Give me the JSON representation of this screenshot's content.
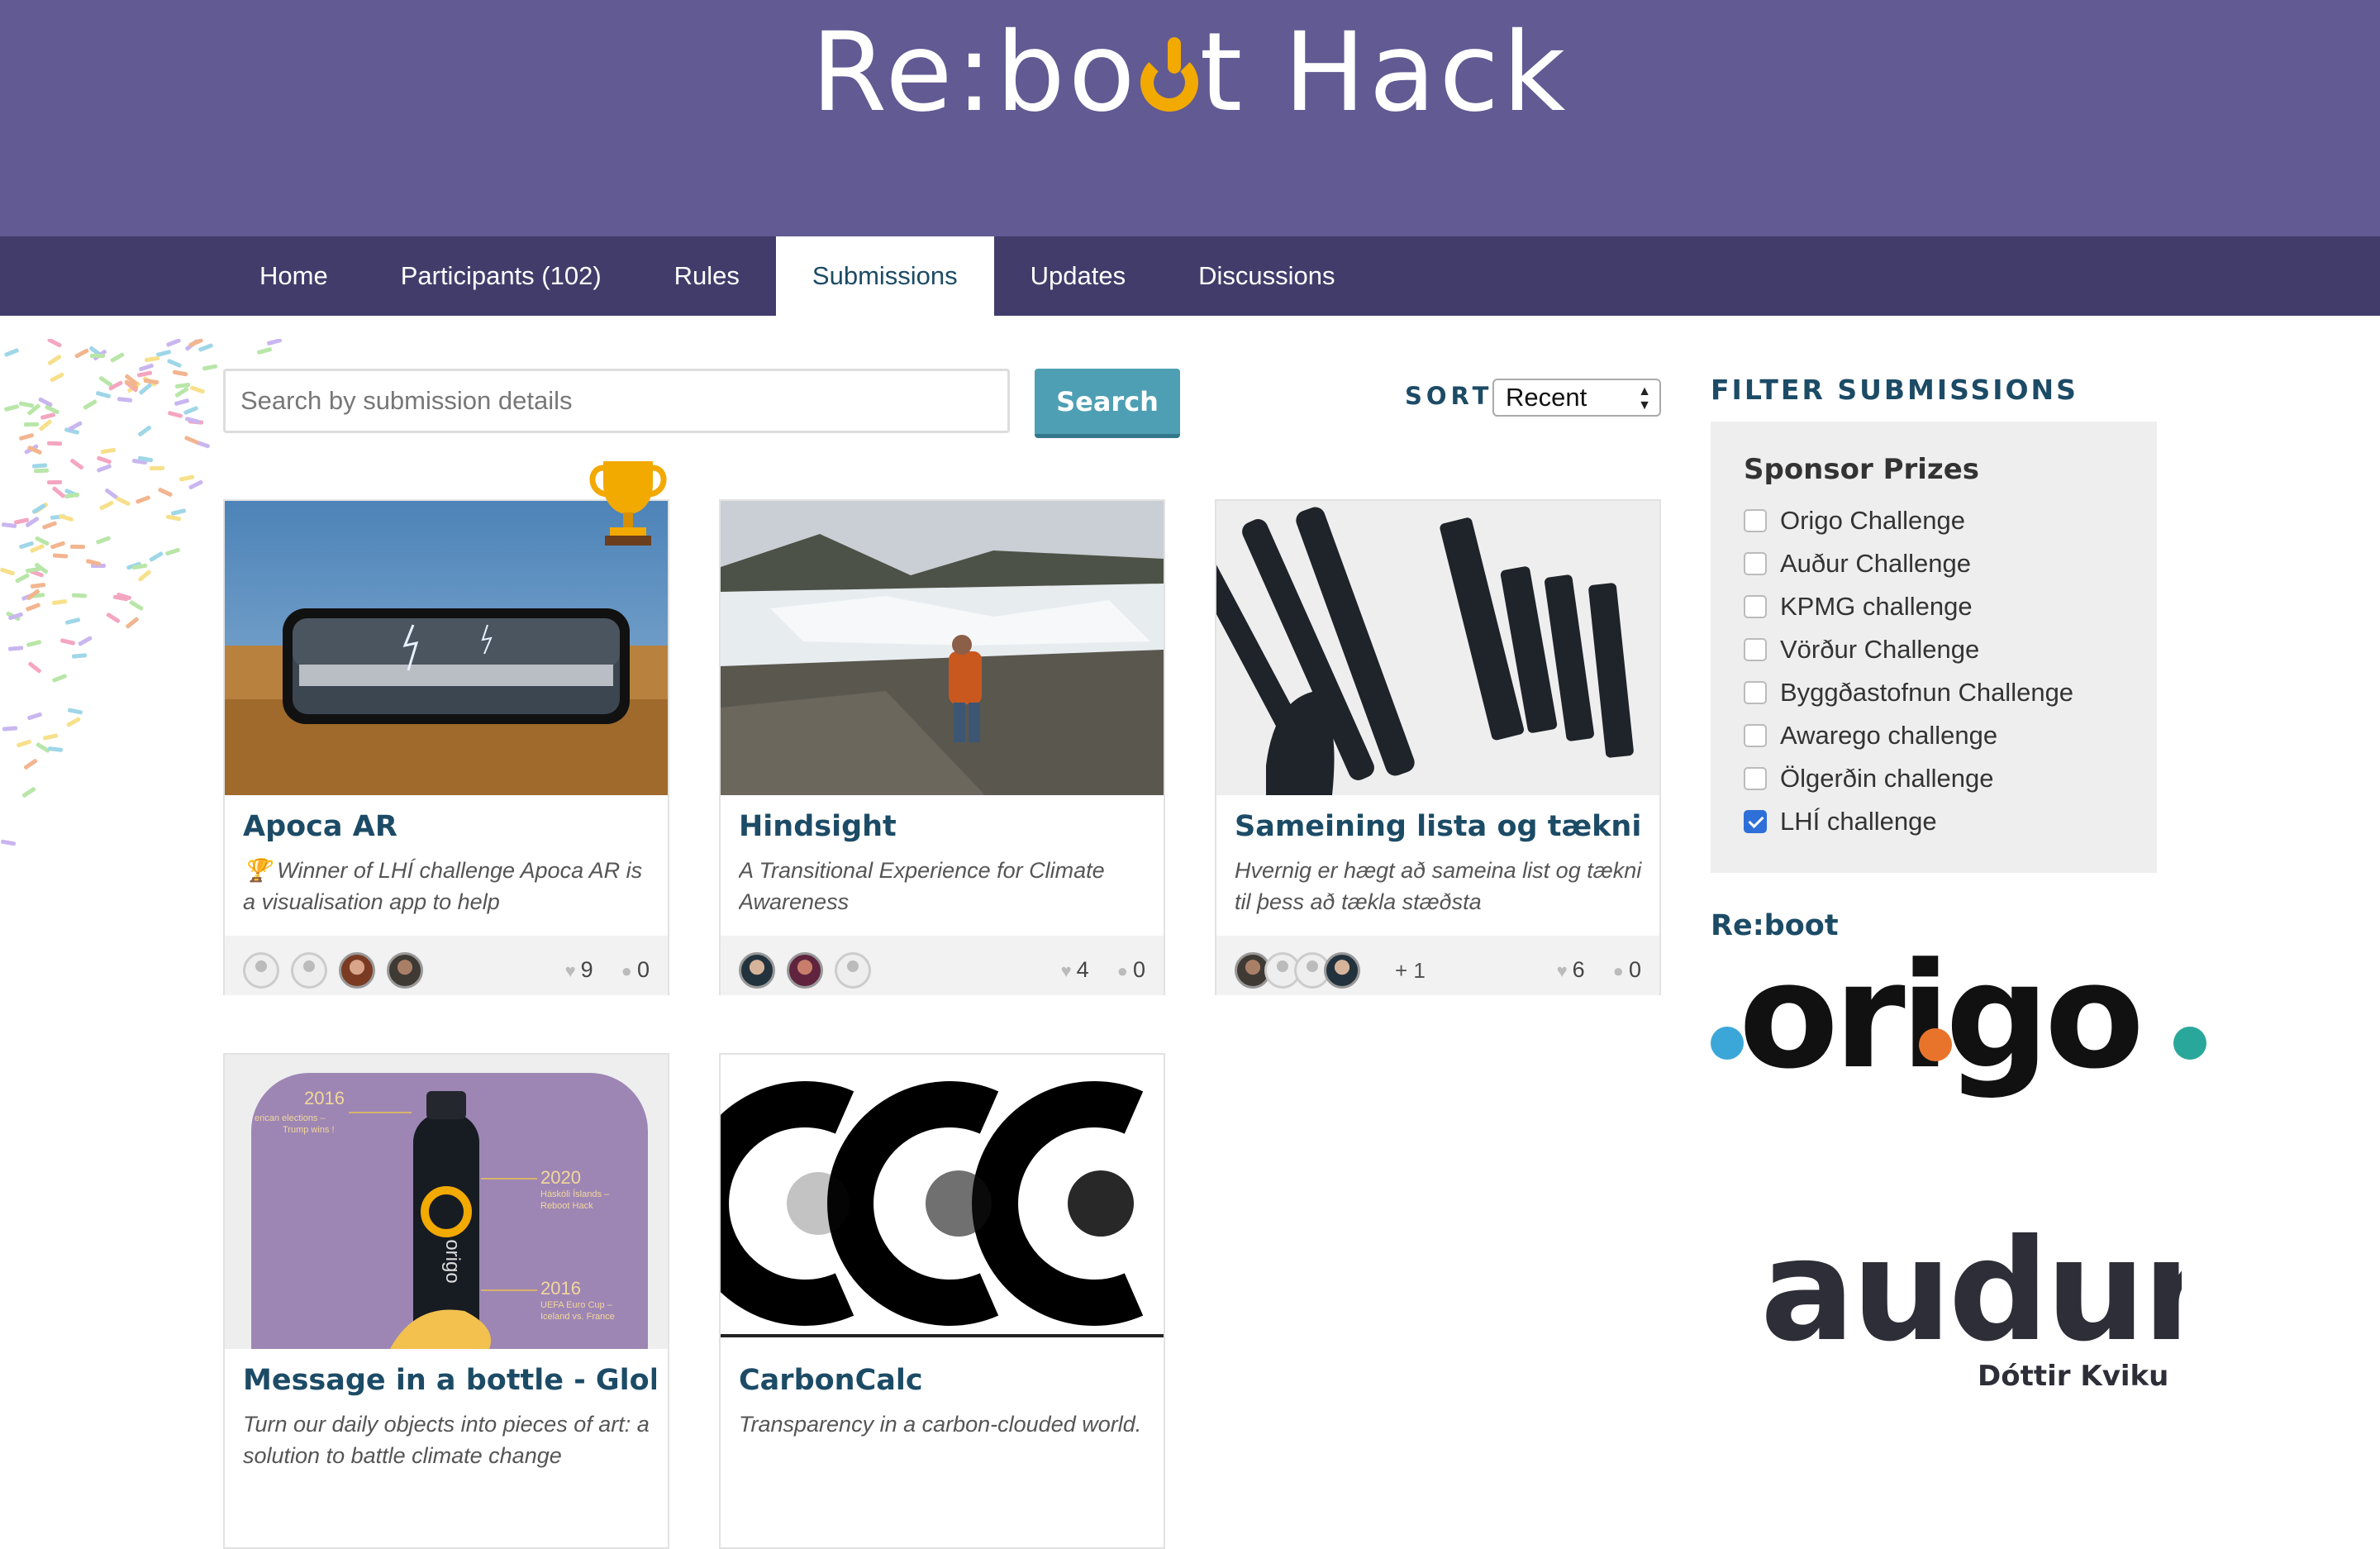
{
  "header": {
    "logo_text": "Re:boot Hack",
    "logo_part1": "Re:bo",
    "logo_part2": "t Hack"
  },
  "nav": [
    {
      "label": "Home"
    },
    {
      "label": "Participants (102)"
    },
    {
      "label": "Rules"
    },
    {
      "label": "Submissions",
      "active": true
    },
    {
      "label": "Updates"
    },
    {
      "label": "Discussions"
    }
  ],
  "search": {
    "placeholder": "Search by submission details",
    "button_label": "Search"
  },
  "sort": {
    "label": "SORT",
    "value": "Recent"
  },
  "submissions": [
    {
      "title": "Apoca AR",
      "description": "🏆 Winner of LHÍ challenge Apoca AR is a visualisation app to help",
      "likes": "9",
      "comments": "0",
      "winner": true
    },
    {
      "title": "Hindsight",
      "description": "A Transitional Experience for Climate Awareness",
      "likes": "4",
      "comments": "0"
    },
    {
      "title": "Sameining lista og tækni",
      "description": "Hvernig er hægt að sameina list og tækni til þess að tækla stæðsta",
      "likes": "6",
      "comments": "0",
      "extra_members": "+ 1"
    },
    {
      "title": "Message in a bottle - Global H",
      "description": "Turn our daily objects into pieces of art: a solution to battle climate change"
    },
    {
      "title": "CarbonCalc",
      "description": "Transparency in a carbon-clouded world."
    }
  ],
  "bottle_image_text": {
    "y2016a": "2016",
    "t1": "erican elections –",
    "t2": "Trump wins !",
    "y2020": "2020",
    "t3": "Háskóli Íslands –",
    "t4": "Reboot Hack",
    "y2016b": "2016",
    "t5": "UEFA Euro Cup –",
    "t6": "Iceland vs. France",
    "brand": "origo"
  },
  "filter": {
    "heading": "FILTER SUBMISSIONS",
    "group_title": "Sponsor Prizes",
    "items": [
      {
        "label": "Origo Challenge",
        "checked": false
      },
      {
        "label": "Auður Challenge",
        "checked": false
      },
      {
        "label": "KPMG challenge",
        "checked": false
      },
      {
        "label": "Vörður Challenge",
        "checked": false
      },
      {
        "label": "Byggðastofnun Challenge",
        "checked": false
      },
      {
        "label": "Awarego challenge",
        "checked": false
      },
      {
        "label": "Ölgerðin challenge",
        "checked": false
      },
      {
        "label": "LHÍ challenge",
        "checked": true
      }
    ]
  },
  "sponsors": {
    "label": "Re:boot",
    "origo_text": "origo",
    "audur_text": "audur",
    "audur_sub": "Dóttir Kviku"
  },
  "colors": {
    "banner": "#615a93",
    "nav": "#423c6b",
    "accent": "#4e9fb3",
    "title": "#1c4b66",
    "trophy": "#f2a900",
    "origo_blue": "#3ba7d8",
    "origo_orange": "#e8742c",
    "origo_teal": "#2aa79b"
  }
}
